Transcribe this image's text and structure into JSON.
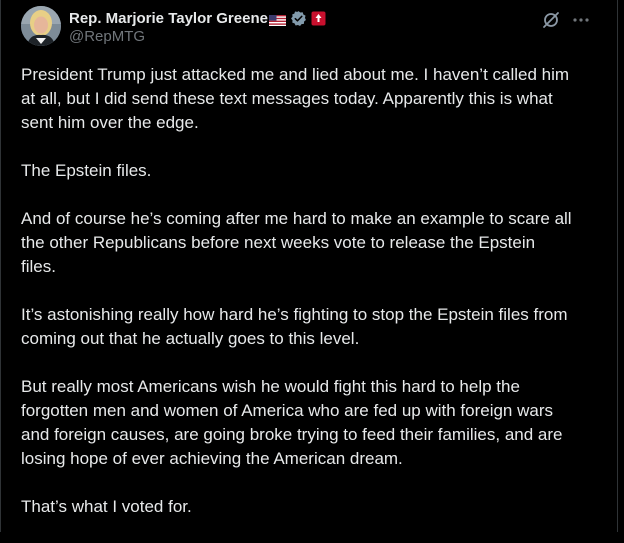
{
  "author": {
    "display_name": "Rep. Marjorie Taylor Greene",
    "handle": "@RepMTG",
    "flag_icon": "us-flag-icon",
    "verified_icon": "verified-badge-icon",
    "affiliation_icon": "congress-affiliation-icon"
  },
  "actions": {
    "grok_icon": "grok-icon",
    "more_icon": "more-options-icon"
  },
  "post": {
    "paragraphs": [
      "President Trump just attacked me and lied about me. I haven’t called him\nat all, but I did send these text messages today. Apparently this is what\nsent him over the edge.",
      "The Epstein files.",
      "And of course he’s coming after me hard to make an example to scare all\nthe other Republicans before next weeks vote to release the Epstein\nfiles.",
      "It’s astonishing really how hard he’s fighting to stop the Epstein files from\ncoming out that he actually goes to this level.",
      "But really most Americans wish he would fight this hard to help the\nforgotten men and women of America who are fed up with foreign wars\nand foreign causes, are going broke trying to feed their families, and are\nlosing hope of ever achieving the American dream.",
      "That’s what I voted for."
    ]
  },
  "colors": {
    "background": "#000000",
    "text": "#e7e9ea",
    "secondary_text": "#71767b",
    "verified_badge": "#829aab",
    "affiliation_badge": "#c8102e"
  }
}
